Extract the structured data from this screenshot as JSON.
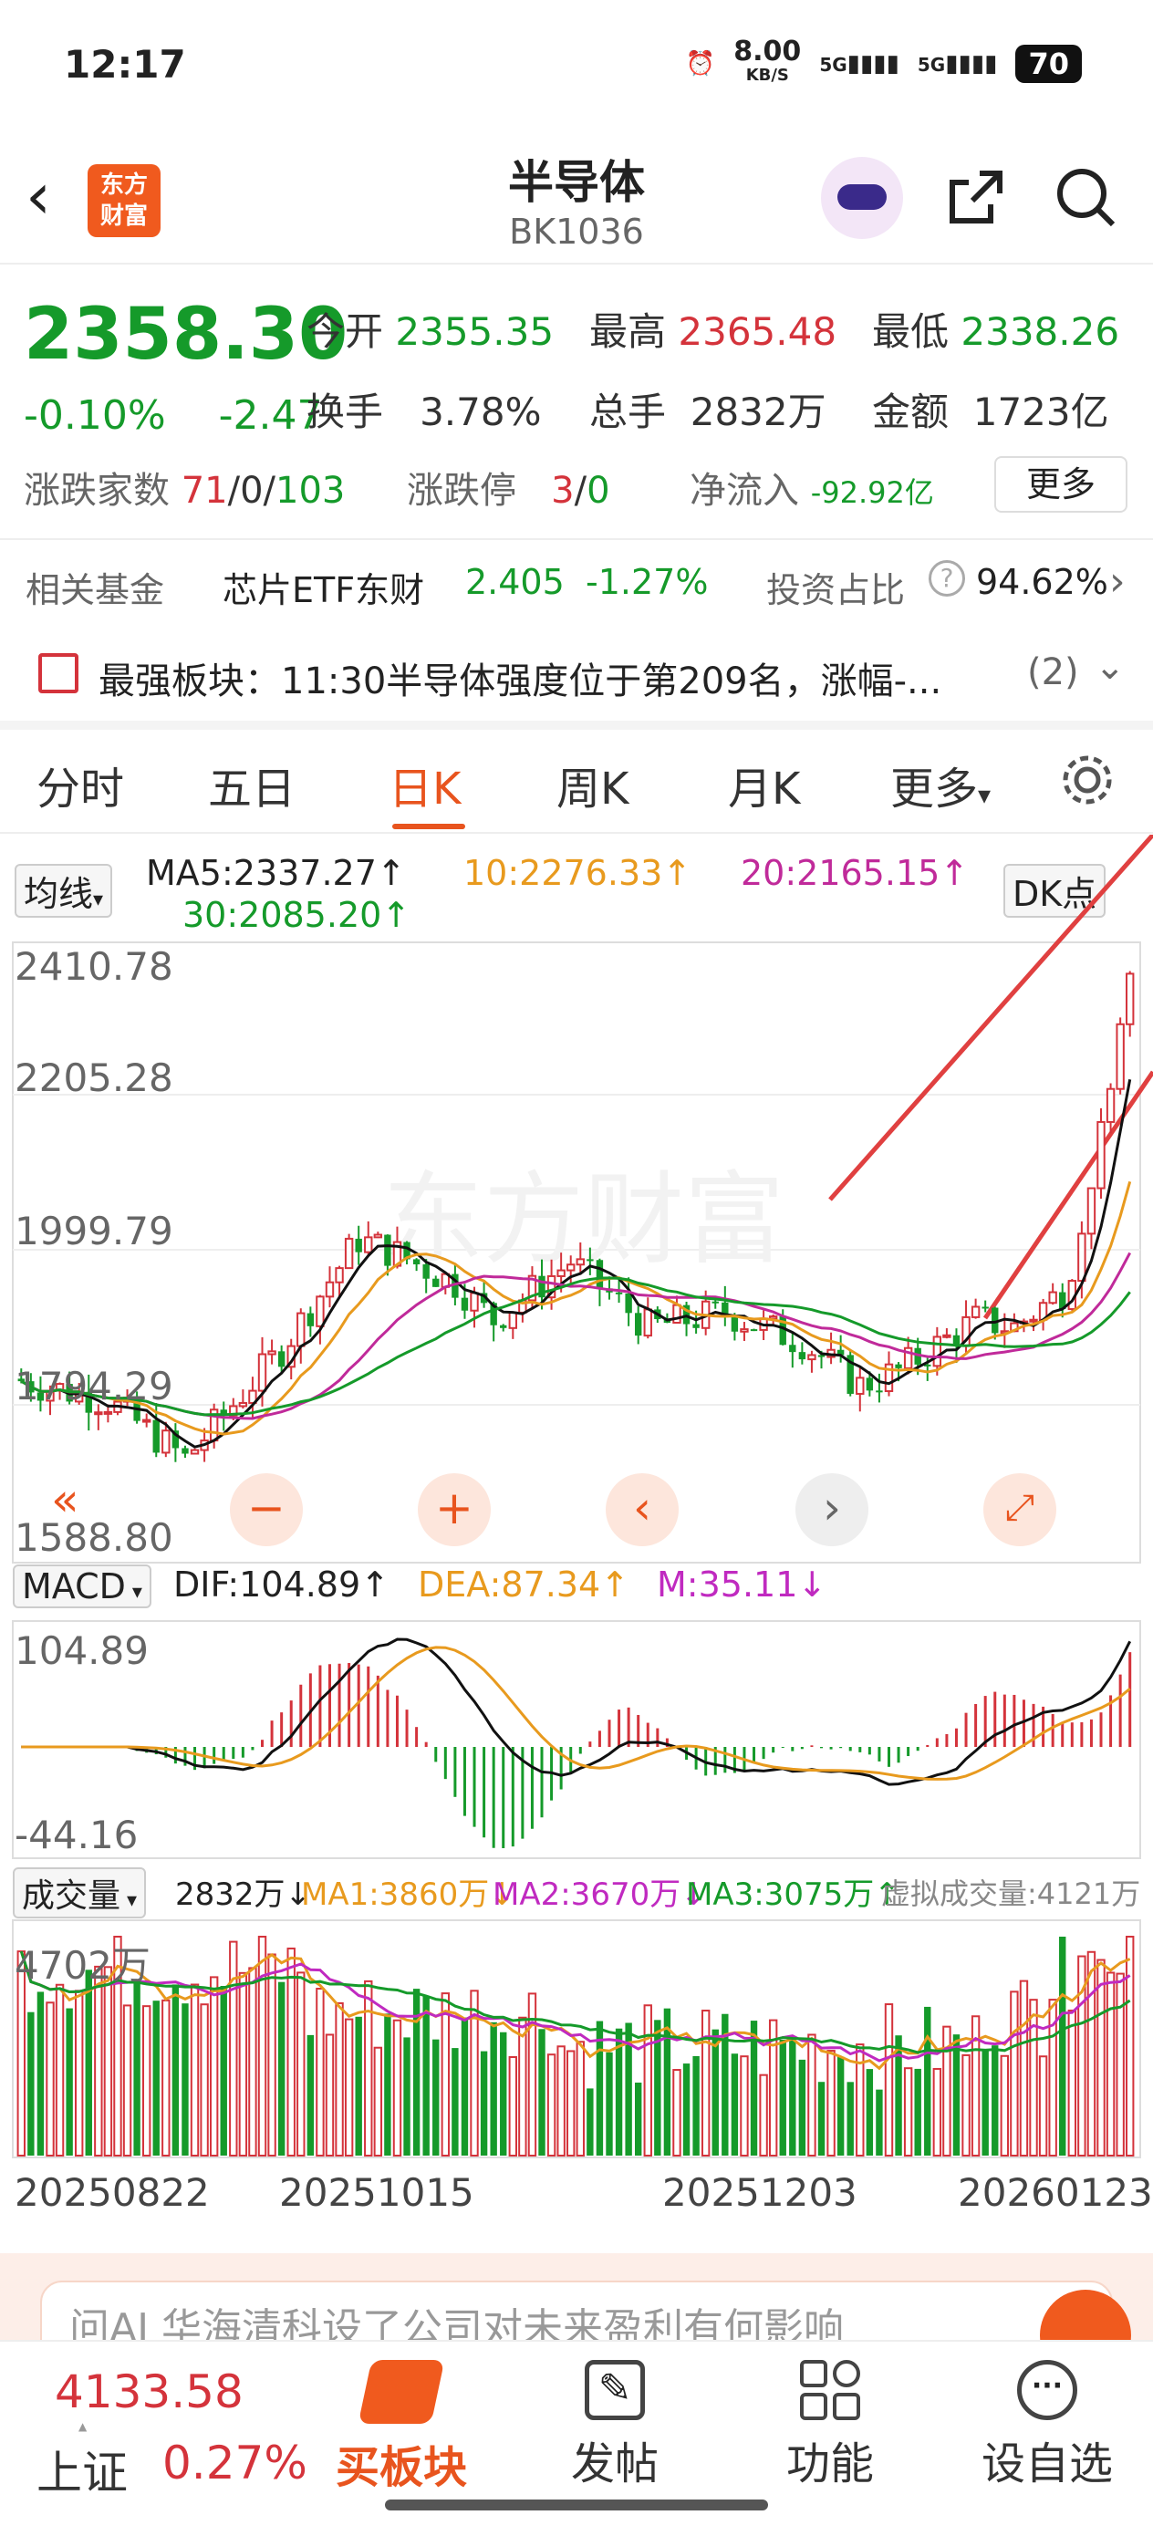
{
  "status_bar": {
    "time": "12:17",
    "net_speed": "8.00",
    "net_unit": "KB/S",
    "sig1": "5G",
    "sig2": "5G",
    "battery": "70"
  },
  "header": {
    "logo_line1": "东方",
    "logo_line2": "财富",
    "title": "半导体",
    "code": "BK1036"
  },
  "quote": {
    "price": "2358.30",
    "change_pct": "-0.10%",
    "change_val": "-2.47",
    "open_label": "今开",
    "open": "2355.35",
    "high_label": "最高",
    "high": "2365.48",
    "low_label": "最低",
    "low": "2338.26",
    "turnover_label": "换手",
    "turnover": "3.78%",
    "volume_label": "总手",
    "volume": "2832万",
    "amount_label": "金额",
    "amount": "1723亿",
    "breadth_label": "涨跌家数",
    "breadth_up": "71",
    "breadth_flat": "/0/",
    "breadth_down": "103",
    "limit_label": "涨跌停",
    "limit_up": "3",
    "limit_sep": "/",
    "limit_down": "0",
    "netflow_label": "净流入",
    "netflow": "-92.92亿",
    "more_button": "更多"
  },
  "fund_row": {
    "label": "相关基金",
    "fund_name": "芯片ETF东财",
    "fund_price": "2.405",
    "fund_change": "-1.27%",
    "ratio_label": "投资占比",
    "ratio_value": "94.62%"
  },
  "news_row": {
    "text": "最强板块：11:30半导体强度位于第209名，涨幅-...",
    "count": "(2)"
  },
  "tabs": [
    "分时",
    "五日",
    "日K",
    "周K",
    "月K",
    "更多"
  ],
  "active_tab": "日K",
  "kline": {
    "indicator_select": "均线",
    "ma5": "MA5:2337.27↑",
    "ma10": "10:2276.33↑",
    "ma20": "20:2165.15↑",
    "ma30": "30:2085.20↑",
    "dk_button": "DK点",
    "y_labels": [
      "2410.78",
      "2205.28",
      "1999.79",
      "1794.29",
      "1588.80"
    ],
    "watermark": "东方财富"
  },
  "macd": {
    "indicator_select": "MACD",
    "dif": "DIF:104.89↑",
    "dea": "DEA:87.34↑",
    "m": "M:35.11↓",
    "y_top": "104.89",
    "y_bottom": "-44.16"
  },
  "volume": {
    "indicator_select": "成交量",
    "current": "2832万↓",
    "ma1": "MA1:3860万↓",
    "ma2": "MA2:3670万↓",
    "ma3": "MA3:3075万↑",
    "virtual": "虚拟成交量:4121万",
    "y_top": "4702万"
  },
  "x_labels": [
    "20250822",
    "20251015",
    "20251203",
    "20260123"
  ],
  "ad": {
    "text": "问AI 华海清科设了公司对未来盈利有何影响"
  },
  "bottom_nav": {
    "index_value": "4133.58",
    "index_name": "上证",
    "index_change": "0.27%",
    "buy_label": "买板块",
    "post_label": "发帖",
    "func_label": "功能",
    "watch_label": "设自选"
  },
  "colors": {
    "up": "#d4333b",
    "down": "#159a2a",
    "accent": "#e8541e",
    "ma10": "#e89a1e",
    "ma20": "#c02a9a"
  }
}
